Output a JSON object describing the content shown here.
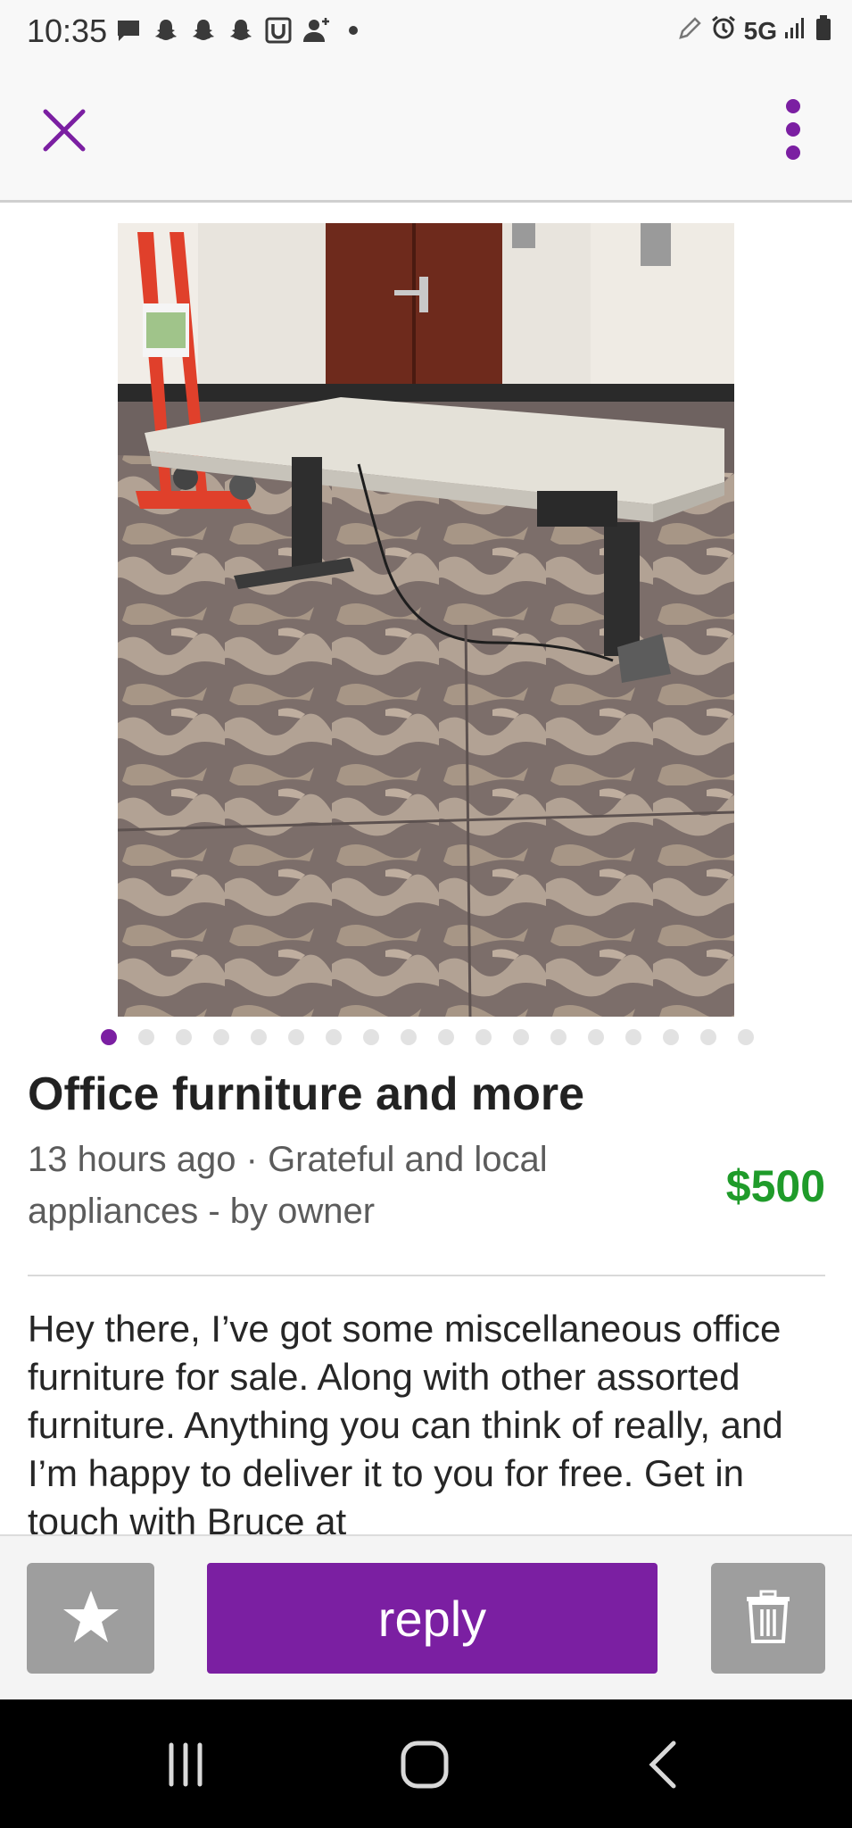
{
  "status_bar": {
    "time": "10:35",
    "network": "5G",
    "left_icons": [
      "message-icon",
      "snapchat-icon",
      "snapchat-icon",
      "snapchat-icon",
      "u-app-icon",
      "add-person-icon",
      "dot-icon"
    ],
    "right_icons": [
      "edit-icon",
      "alarm-icon",
      "signal-icon",
      "battery-icon"
    ]
  },
  "app_bar": {
    "close_icon": "close-icon",
    "menu_icon": "more-vert-icon",
    "accent_color": "#7b1fa2"
  },
  "gallery": {
    "photo_description_icon": "listing-photo",
    "total_images": 18,
    "active_index": 0
  },
  "listing": {
    "title": "Office furniture and more",
    "meta_line1": "13 hours ago · Grateful and local",
    "meta_line2": "appliances - by owner",
    "price": "$500",
    "price_color": "#1f9b2a",
    "description": "Hey there, I’ve got some miscellaneous office furniture for sale. Along with other assorted furniture. Anything you can think of really, and I’m happy to deliver it to you for free. Get in touch with Bruce at"
  },
  "actions": {
    "favorite_icon": "star-icon",
    "reply_label": "reply",
    "delete_icon": "trash-icon"
  },
  "nav_bar": {
    "recents_icon": "recents-icon",
    "home_icon": "home-icon",
    "back_icon": "back-icon"
  }
}
